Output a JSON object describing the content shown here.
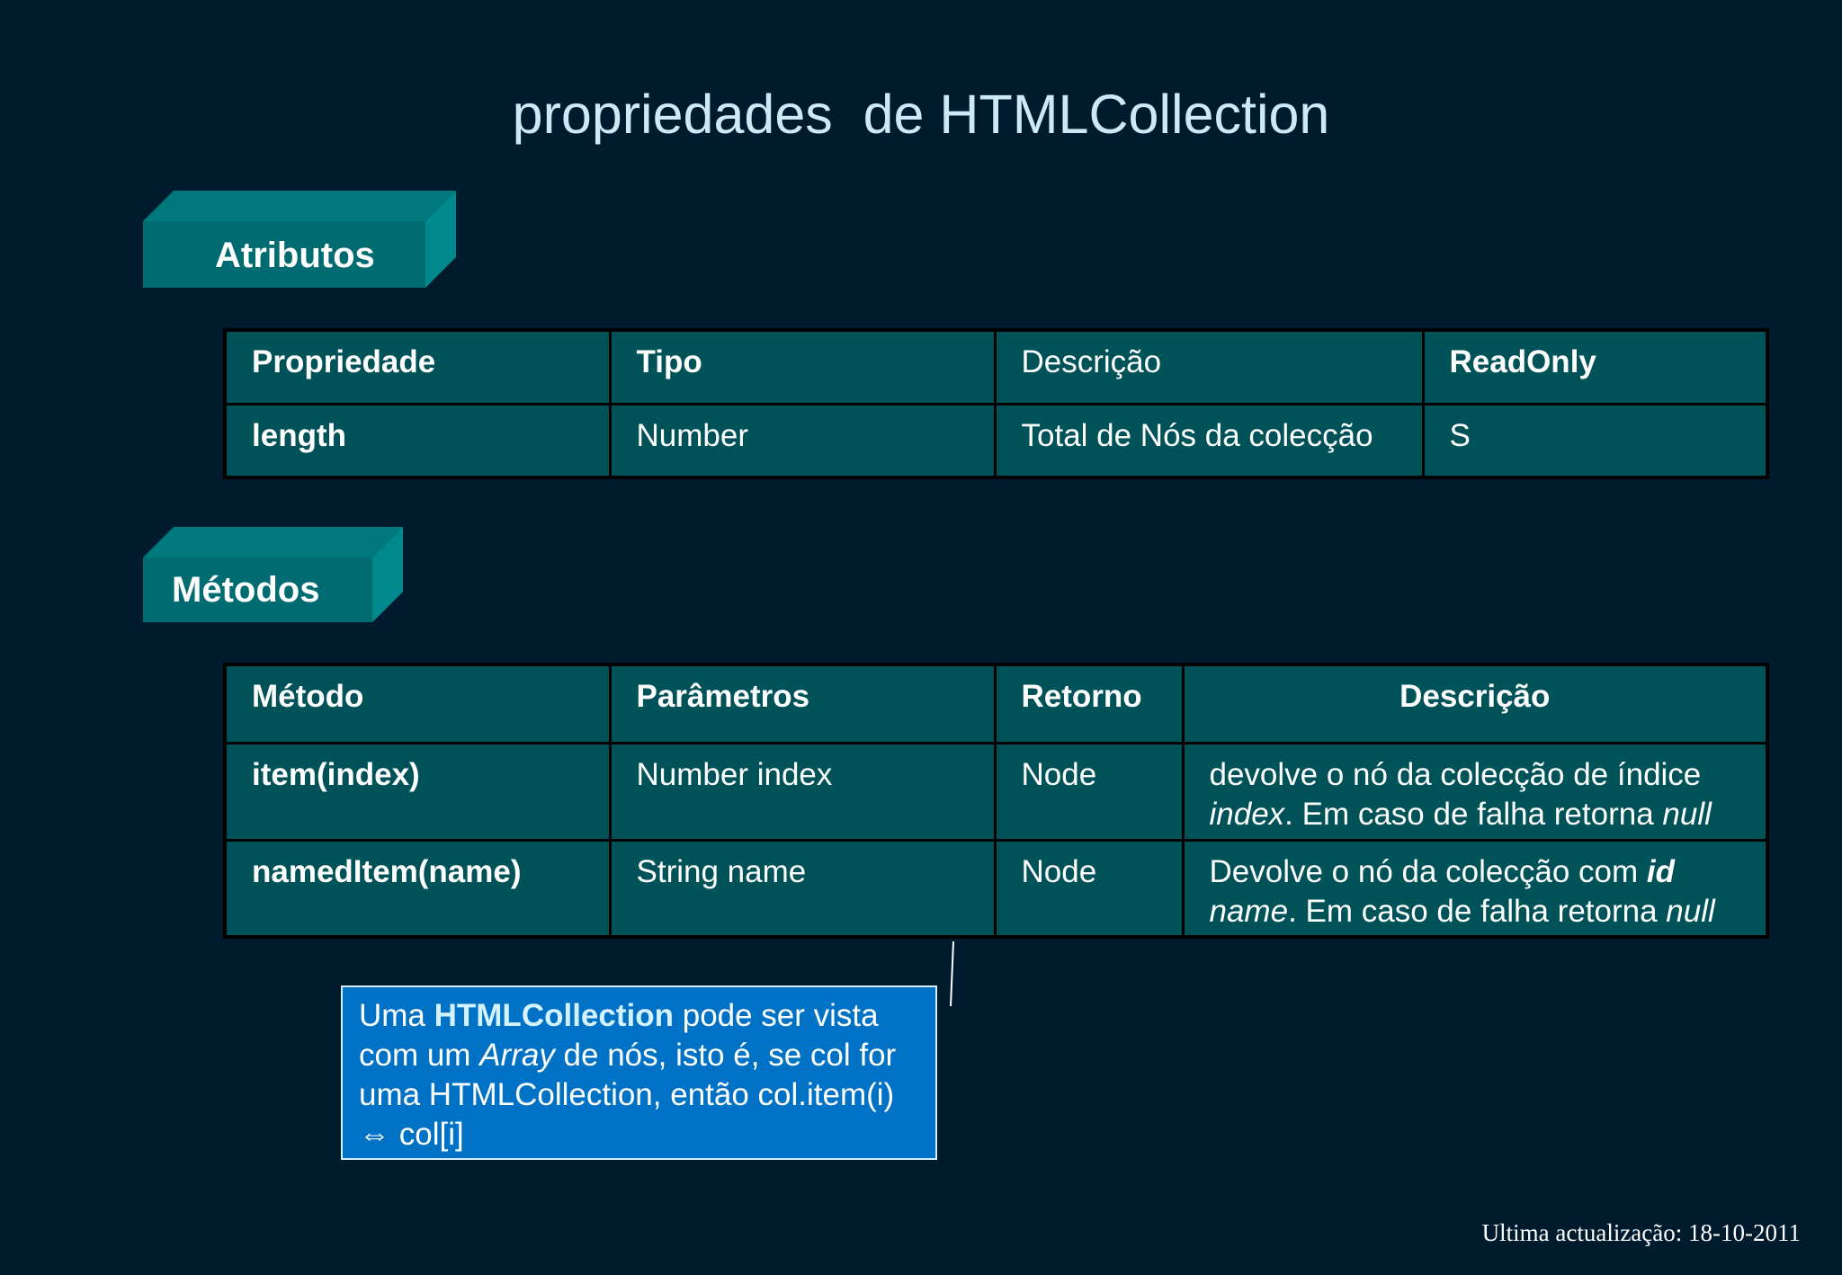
{
  "title": "propriedades  de HTMLCollection",
  "sections": {
    "atributos": "Atributos",
    "metodos": "Métodos"
  },
  "attributes_table": {
    "headers": [
      "Propriedade",
      "Tipo",
      "Descrição",
      "ReadOnly"
    ],
    "rows": [
      [
        "length",
        "Number",
        "Total de Nós da colecção",
        "S"
      ]
    ]
  },
  "methods_table": {
    "headers": [
      "Método",
      "Parâmetros",
      "Retorno",
      "Descrição"
    ],
    "rows": [
      {
        "method": "item(index)",
        "params": "Number index",
        "returns": "Node",
        "desc": {
          "p1": "devolve o nó da colecção de índice ",
          "em1": "index",
          "p2": ". Em caso de falha retorna ",
          "em2": "null"
        }
      },
      {
        "method": "namedItem(name)",
        "params": "String name",
        "returns": "Node",
        "desc": {
          "p1": "Devolve o nó da colecção com ",
          "strong": "id",
          "em1": "name",
          "p2": ". Em caso de falha retorna ",
          "em2": "null"
        }
      }
    ]
  },
  "callout": {
    "t1": "Uma ",
    "hl": "HTMLCollection",
    "t2": " pode ser vista com um ",
    "em": "Array",
    "t3": " de nós, isto é, se col for uma HTMLCollection, então col.item(i) ",
    "symbol": "⇔",
    "t4": " col[i]"
  },
  "footer": "Ultima actualização: 18-10-2011",
  "colors": {
    "background": "#001b2e",
    "cell": "#005259",
    "box_front": "#006b70",
    "box_side": "#00898c",
    "callout": "#0072c6"
  }
}
